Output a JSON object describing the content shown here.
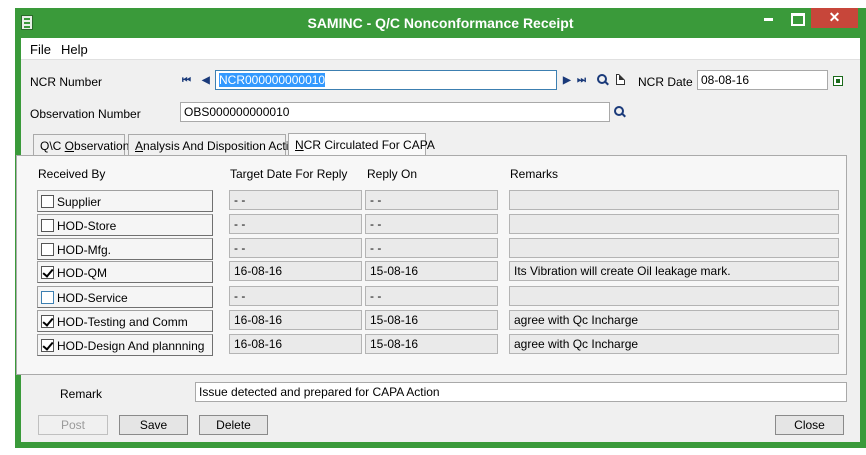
{
  "window": {
    "title": "SAMINC - Q/C Nonconformance Receipt",
    "close_glyph": "✕"
  },
  "menu": [
    "File",
    "Help"
  ],
  "form": {
    "ncr_number_label": "NCR Number",
    "ncr_number_value": "NCR000000000010",
    "ncr_date_label": "NCR Date",
    "ncr_date_value": "08-08-16",
    "observation_label": "Observation Number",
    "observation_value": "OBS000000000010"
  },
  "tabs": [
    {
      "label": "Q\\C Observation",
      "underline": "O",
      "active": false
    },
    {
      "label": "Analysis And Disposition Action",
      "underline": "A",
      "active": false
    },
    {
      "label": "NCR Circulated For CAPA",
      "underline": "N",
      "active": true
    }
  ],
  "table": {
    "headers": [
      "Received By",
      "Target Date For Reply",
      "Reply On",
      "Remarks"
    ],
    "rows": [
      {
        "name": "Supplier",
        "checked": false,
        "target": "-  -",
        "reply": "-  -",
        "remarks": ""
      },
      {
        "name": "HOD-Store",
        "checked": false,
        "target": "-  -",
        "reply": "-  -",
        "remarks": ""
      },
      {
        "name": "HOD-Mfg.",
        "checked": false,
        "target": "-  -",
        "reply": "-  -",
        "remarks": ""
      },
      {
        "name": "HOD-QM",
        "checked": true,
        "target": "16-08-16",
        "reply": "15-08-16",
        "remarks": "Its Vibration will create Oil leakage mark."
      },
      {
        "name": "HOD-Service",
        "checked": false,
        "target": "-  -",
        "reply": "-  -",
        "remarks": ""
      },
      {
        "name": "HOD-Testing and Comm",
        "checked": true,
        "target": "16-08-16",
        "reply": "15-08-16",
        "remarks": "agree with Qc Incharge"
      },
      {
        "name": "HOD-Design And plannning",
        "checked": true,
        "target": "16-08-16",
        "reply": "15-08-16",
        "remarks": "agree with Qc Incharge"
      }
    ]
  },
  "remark": {
    "label": "Remark",
    "value": "Issue detected and prepared for CAPA Action"
  },
  "buttons": {
    "post": "Post",
    "save": "Save",
    "delete": "Delete",
    "close": "Close"
  },
  "nav_glyphs": {
    "first": "⏮",
    "prev": "◀",
    "next": "▶",
    "last": "⏭"
  },
  "colors": {
    "titlebar": "#3a9a3a",
    "close_button": "#c7463a",
    "selection": "#3399ff"
  }
}
